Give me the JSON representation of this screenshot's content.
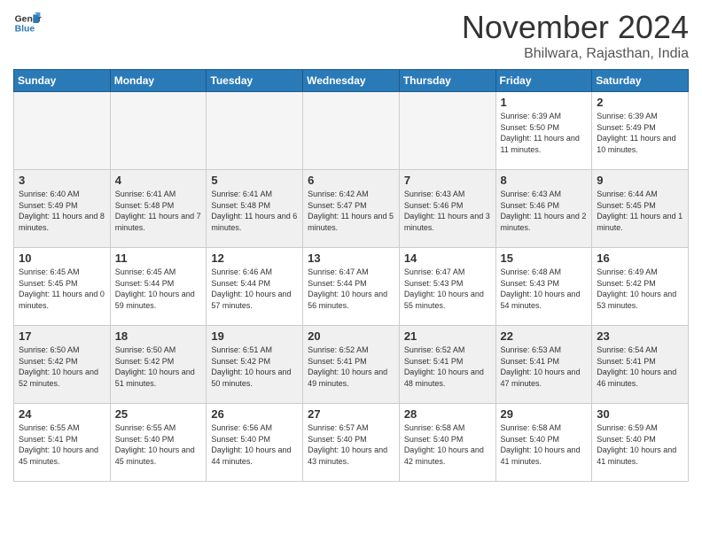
{
  "logo": {
    "line1": "General",
    "line2": "Blue"
  },
  "title": "November 2024",
  "location": "Bhilwara, Rajasthan, India",
  "days_of_week": [
    "Sunday",
    "Monday",
    "Tuesday",
    "Wednesday",
    "Thursday",
    "Friday",
    "Saturday"
  ],
  "weeks": [
    [
      {
        "day": "",
        "info": "",
        "empty": true
      },
      {
        "day": "",
        "info": "",
        "empty": true
      },
      {
        "day": "",
        "info": "",
        "empty": true
      },
      {
        "day": "",
        "info": "",
        "empty": true
      },
      {
        "day": "",
        "info": "",
        "empty": true
      },
      {
        "day": "1",
        "info": "Sunrise: 6:39 AM\nSunset: 5:50 PM\nDaylight: 11 hours and 11 minutes."
      },
      {
        "day": "2",
        "info": "Sunrise: 6:39 AM\nSunset: 5:49 PM\nDaylight: 11 hours and 10 minutes."
      }
    ],
    [
      {
        "day": "3",
        "info": "Sunrise: 6:40 AM\nSunset: 5:49 PM\nDaylight: 11 hours and 8 minutes."
      },
      {
        "day": "4",
        "info": "Sunrise: 6:41 AM\nSunset: 5:48 PM\nDaylight: 11 hours and 7 minutes."
      },
      {
        "day": "5",
        "info": "Sunrise: 6:41 AM\nSunset: 5:48 PM\nDaylight: 11 hours and 6 minutes."
      },
      {
        "day": "6",
        "info": "Sunrise: 6:42 AM\nSunset: 5:47 PM\nDaylight: 11 hours and 5 minutes."
      },
      {
        "day": "7",
        "info": "Sunrise: 6:43 AM\nSunset: 5:46 PM\nDaylight: 11 hours and 3 minutes."
      },
      {
        "day": "8",
        "info": "Sunrise: 6:43 AM\nSunset: 5:46 PM\nDaylight: 11 hours and 2 minutes."
      },
      {
        "day": "9",
        "info": "Sunrise: 6:44 AM\nSunset: 5:45 PM\nDaylight: 11 hours and 1 minute."
      }
    ],
    [
      {
        "day": "10",
        "info": "Sunrise: 6:45 AM\nSunset: 5:45 PM\nDaylight: 11 hours and 0 minutes."
      },
      {
        "day": "11",
        "info": "Sunrise: 6:45 AM\nSunset: 5:44 PM\nDaylight: 10 hours and 59 minutes."
      },
      {
        "day": "12",
        "info": "Sunrise: 6:46 AM\nSunset: 5:44 PM\nDaylight: 10 hours and 57 minutes."
      },
      {
        "day": "13",
        "info": "Sunrise: 6:47 AM\nSunset: 5:44 PM\nDaylight: 10 hours and 56 minutes."
      },
      {
        "day": "14",
        "info": "Sunrise: 6:47 AM\nSunset: 5:43 PM\nDaylight: 10 hours and 55 minutes."
      },
      {
        "day": "15",
        "info": "Sunrise: 6:48 AM\nSunset: 5:43 PM\nDaylight: 10 hours and 54 minutes."
      },
      {
        "day": "16",
        "info": "Sunrise: 6:49 AM\nSunset: 5:42 PM\nDaylight: 10 hours and 53 minutes."
      }
    ],
    [
      {
        "day": "17",
        "info": "Sunrise: 6:50 AM\nSunset: 5:42 PM\nDaylight: 10 hours and 52 minutes."
      },
      {
        "day": "18",
        "info": "Sunrise: 6:50 AM\nSunset: 5:42 PM\nDaylight: 10 hours and 51 minutes."
      },
      {
        "day": "19",
        "info": "Sunrise: 6:51 AM\nSunset: 5:42 PM\nDaylight: 10 hours and 50 minutes."
      },
      {
        "day": "20",
        "info": "Sunrise: 6:52 AM\nSunset: 5:41 PM\nDaylight: 10 hours and 49 minutes."
      },
      {
        "day": "21",
        "info": "Sunrise: 6:52 AM\nSunset: 5:41 PM\nDaylight: 10 hours and 48 minutes."
      },
      {
        "day": "22",
        "info": "Sunrise: 6:53 AM\nSunset: 5:41 PM\nDaylight: 10 hours and 47 minutes."
      },
      {
        "day": "23",
        "info": "Sunrise: 6:54 AM\nSunset: 5:41 PM\nDaylight: 10 hours and 46 minutes."
      }
    ],
    [
      {
        "day": "24",
        "info": "Sunrise: 6:55 AM\nSunset: 5:41 PM\nDaylight: 10 hours and 45 minutes."
      },
      {
        "day": "25",
        "info": "Sunrise: 6:55 AM\nSunset: 5:40 PM\nDaylight: 10 hours and 45 minutes."
      },
      {
        "day": "26",
        "info": "Sunrise: 6:56 AM\nSunset: 5:40 PM\nDaylight: 10 hours and 44 minutes."
      },
      {
        "day": "27",
        "info": "Sunrise: 6:57 AM\nSunset: 5:40 PM\nDaylight: 10 hours and 43 minutes."
      },
      {
        "day": "28",
        "info": "Sunrise: 6:58 AM\nSunset: 5:40 PM\nDaylight: 10 hours and 42 minutes."
      },
      {
        "day": "29",
        "info": "Sunrise: 6:58 AM\nSunset: 5:40 PM\nDaylight: 10 hours and 41 minutes."
      },
      {
        "day": "30",
        "info": "Sunrise: 6:59 AM\nSunset: 5:40 PM\nDaylight: 10 hours and 41 minutes."
      }
    ]
  ]
}
